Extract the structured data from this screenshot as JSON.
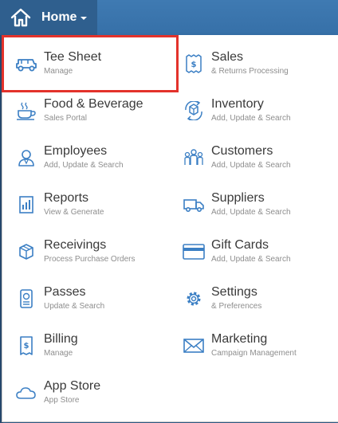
{
  "nav": {
    "home_label": "Home"
  },
  "menu": {
    "items": [
      {
        "title": "Tee Sheet",
        "subtitle": "Manage",
        "icon": "golf-cart-icon"
      },
      {
        "title": "Sales",
        "subtitle": "& Returns Processing",
        "icon": "receipt-icon"
      },
      {
        "title": "Food & Beverage",
        "subtitle": "Sales Portal",
        "icon": "coffee-cup-icon"
      },
      {
        "title": "Inventory",
        "subtitle": "Add, Update & Search",
        "icon": "box-cycle-icon"
      },
      {
        "title": "Employees",
        "subtitle": "Add, Update & Search",
        "icon": "employee-icon"
      },
      {
        "title": "Customers",
        "subtitle": "Add, Update & Search",
        "icon": "people-group-icon"
      },
      {
        "title": "Reports",
        "subtitle": "View & Generate",
        "icon": "report-icon"
      },
      {
        "title": "Suppliers",
        "subtitle": "Add, Update & Search",
        "icon": "truck-icon"
      },
      {
        "title": "Receivings",
        "subtitle": "Process Purchase Orders",
        "icon": "package-icon"
      },
      {
        "title": "Gift Cards",
        "subtitle": "Add, Update & Search",
        "icon": "card-icon"
      },
      {
        "title": "Passes",
        "subtitle": "Update & Search",
        "icon": "pass-icon"
      },
      {
        "title": "Settings",
        "subtitle": "& Preferences",
        "icon": "gear-icon"
      },
      {
        "title": "Billing",
        "subtitle": "Manage",
        "icon": "bill-icon"
      },
      {
        "title": "Marketing",
        "subtitle": "Campaign Management",
        "icon": "envelope-icon"
      },
      {
        "title": "App Store",
        "subtitle": "App Store",
        "icon": "cloud-icon"
      }
    ]
  },
  "colors": {
    "accent": "#3f7ab2",
    "icon": "#3b7fc4",
    "highlight": "#e3322b"
  }
}
